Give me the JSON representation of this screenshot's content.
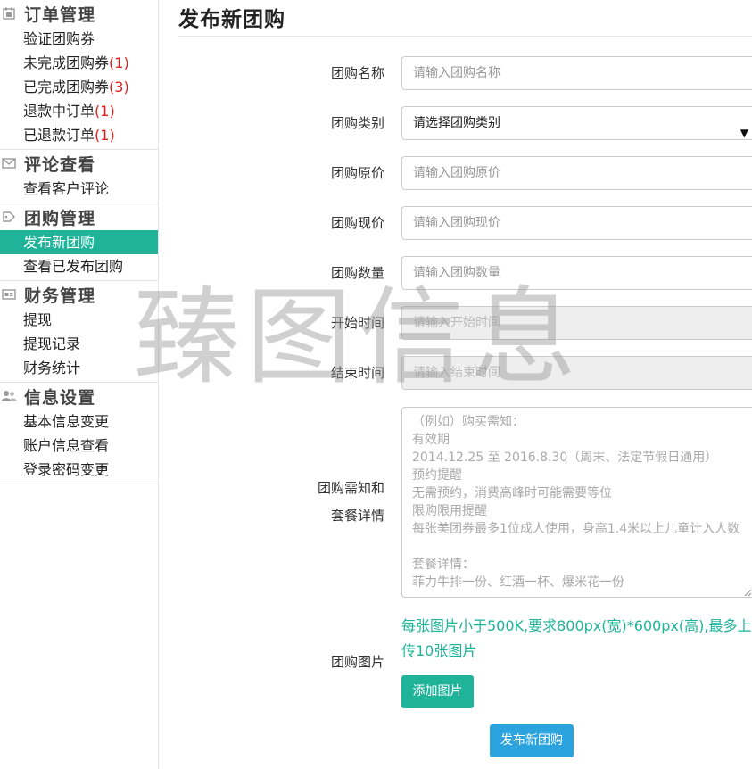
{
  "sidebar": {
    "groups": [
      {
        "title": "订单管理",
        "icon": "calendar-icon",
        "items": [
          {
            "label": "验证团购券",
            "count": ""
          },
          {
            "label": "未完成团购券",
            "count": "(1)"
          },
          {
            "label": "已完成团购券",
            "count": "(3)"
          },
          {
            "label": "退款中订单",
            "count": "(1)"
          },
          {
            "label": "已退款订单",
            "count": "(1)"
          }
        ]
      },
      {
        "title": "评论查看",
        "icon": "envelope-icon",
        "items": [
          {
            "label": "查看客户评论",
            "count": ""
          }
        ]
      },
      {
        "title": "团购管理",
        "icon": "tag-icon",
        "items": [
          {
            "label": "发布新团购",
            "count": "",
            "active": true
          },
          {
            "label": "查看已发布团购",
            "count": ""
          }
        ]
      },
      {
        "title": "财务管理",
        "icon": "money-icon",
        "items": [
          {
            "label": "提现",
            "count": ""
          },
          {
            "label": "提现记录",
            "count": ""
          },
          {
            "label": "财务统计",
            "count": ""
          }
        ]
      },
      {
        "title": "信息设置",
        "icon": "users-icon",
        "items": [
          {
            "label": "基本信息变更",
            "count": ""
          },
          {
            "label": "账户信息查看",
            "count": ""
          },
          {
            "label": "登录密码变更",
            "count": ""
          }
        ]
      }
    ]
  },
  "main": {
    "title": "发布新团购",
    "form": {
      "name": {
        "label": "团购名称",
        "placeholder": "请输入团购名称"
      },
      "category": {
        "label": "团购类别",
        "selected": "请选择团购类别"
      },
      "original_price": {
        "label": "团购原价",
        "placeholder": "请输入团购原价"
      },
      "current_price": {
        "label": "团购现价",
        "placeholder": "请输入团购现价"
      },
      "quantity": {
        "label": "团购数量",
        "placeholder": "请输入团购数量"
      },
      "start_time": {
        "label": "开始时间",
        "placeholder": "请输入开始时间"
      },
      "end_time": {
        "label": "结束时间",
        "placeholder": "请输入结束时间"
      },
      "notes": {
        "label_line1": "团购需知和",
        "label_line2": "套餐详情",
        "placeholder_lines": [
          "（例如）购买需知：",
          "有效期",
          "2014.12.25 至 2016.8.30（周末、法定节假日通用）",
          "预约提醒",
          "无需预约，消费高峰时可能需要等位",
          "限购限用提醒",
          "每张美团券最多1位成人使用，身高1.4米以上儿童计入人数",
          "",
          "套餐详情：",
          "菲力牛排一份、红酒一杯、爆米花一份"
        ]
      },
      "images": {
        "label": "团购图片",
        "hint": "每张图片小于500K,要求800px(宽)*600px(高),最多上传10张图片",
        "add_button": "添加图片"
      },
      "submit_button": "发布新团购"
    }
  },
  "watermark": "臻图信息",
  "colors": {
    "accent": "#1fb39a",
    "submit": "#2ba3de",
    "count": "#e02020"
  }
}
